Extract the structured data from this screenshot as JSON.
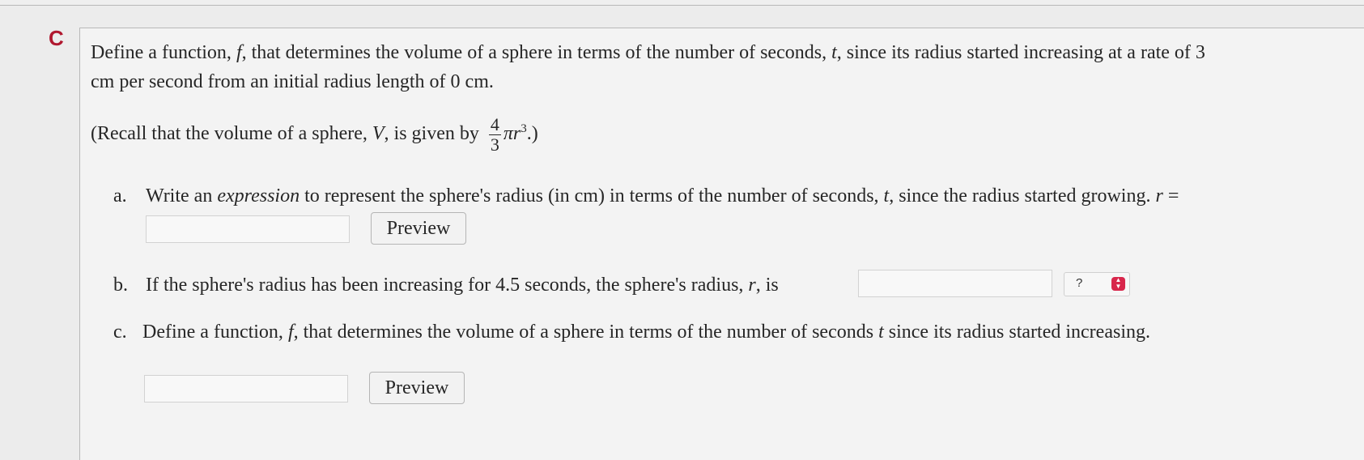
{
  "question": {
    "marker": "C",
    "intro_line1_a": "Define a function, ",
    "intro_line1_f": "f",
    "intro_line1_b": ", that determines the volume of a sphere in terms of the number of seconds, ",
    "intro_line1_t": "t",
    "intro_line1_c": ", since its radius started increasing at a rate of 3",
    "intro_line2": "cm per second from an initial radius length of 0 cm.",
    "recall_a": "(Recall that the volume of a sphere, ",
    "recall_v": "V",
    "recall_b": ", is given by ",
    "recall_num": "4",
    "recall_den": "3",
    "recall_pi_r": "πr",
    "recall_exp": "3",
    "recall_c": ".)"
  },
  "parts": {
    "a": {
      "label": "a.",
      "text_a": "Write an ",
      "text_em": "expression",
      "text_b": " to represent the sphere's radius (in cm) in terms of the number of seconds, ",
      "text_t": "t",
      "text_c": ", since the radius started growing. ",
      "text_r": "r",
      "text_eq": " =",
      "preview_label": "Preview"
    },
    "b": {
      "label": "b.",
      "text_a": "If the sphere's radius has been increasing for 4.5 seconds, the sphere's radius, ",
      "text_r": "r",
      "text_b": ", is",
      "select_value": "?"
    },
    "c": {
      "label": "c.",
      "text_a": "Define a function, ",
      "text_f": "f",
      "text_b": ", that determines the volume of a sphere in terms of the number of seconds ",
      "text_t": "t",
      "text_c": " since its radius started increasing.",
      "preview_label": "Preview"
    }
  },
  "colors": {
    "marker": "#b0182f",
    "select_accent": "#d8264b"
  }
}
